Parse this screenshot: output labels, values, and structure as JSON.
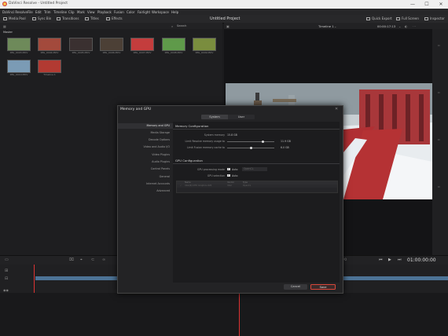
{
  "window": {
    "title": "DaVinci Resolve - Untitled Project",
    "minimize": "—",
    "maximize": "☐",
    "close": "✕"
  },
  "menu": [
    "DaVinci Resolve",
    "File",
    "Edit",
    "Trim",
    "Timeline",
    "Clip",
    "Mark",
    "View",
    "Playback",
    "Fusion",
    "Color",
    "Fairlight",
    "Workspace",
    "Help"
  ],
  "toolbar": {
    "media_pool": "Media Pool",
    "sync_bin": "Sync Bin",
    "transitions": "Transitions",
    "titles": "Titles",
    "effects": "Effects",
    "project_title": "Untitled Project",
    "quick_export": "Quick Export",
    "full_screen": "Full Screen",
    "inspector": "Inspector"
  },
  "pool": {
    "search": "Search",
    "bin_name": "Master",
    "clips": [
      {
        "label": "IMG_0403.MOV",
        "color": "#6e8a5a"
      },
      {
        "label": "IMG_0404.MOV",
        "color": "#a34a3c"
      },
      {
        "label": "IMG_0405.MOV",
        "color": "#3a3030"
      },
      {
        "label": "IMG_0406.MOV",
        "color": "#4c4036"
      },
      {
        "label": "IMG_0407.MOV",
        "color": "#c43d3d"
      },
      {
        "label": "IMG_0408.MOV",
        "color": "#5f9a4a"
      },
      {
        "label": "IMG_0409.MOV",
        "color": "#7a8d3e"
      },
      {
        "label": "IMG_0410.MOV",
        "color": "#7b9bb5"
      },
      {
        "label": "Timeline 1",
        "color": "#b23a32"
      }
    ]
  },
  "viewer": {
    "timeline_name": "Timeline 1",
    "source_timecode": "00:00:17:13",
    "timecode": "01:00:00:00"
  },
  "dialog": {
    "title": "Memory and GPU",
    "close": "✕",
    "tabs": [
      "System",
      "User"
    ],
    "active_tab": "System",
    "nav": [
      "Memory and GPU",
      "Media Storage",
      "Decode Options",
      "Video and Audio I/O",
      "Video Plugins",
      "Audio Plugins",
      "Control Panels",
      "General",
      "Internet Accounts",
      "Advanced"
    ],
    "memory": {
      "section": "Memory Configuration",
      "system_memory_label": "System memory",
      "system_memory_value": "15.8 GB",
      "resolve_label": "Limit Resolve memory usage to",
      "resolve_value": "11.9 GB",
      "resolve_fraction": 0.75,
      "fusion_label": "Limit Fusion memory cache to",
      "fusion_value": "6.0 GB",
      "fusion_fraction": 0.5
    },
    "gpu": {
      "section": "GPU Configuration",
      "processing_label": "GPU processing mode",
      "processing_auto": "Auto",
      "processing_mode": "OpenCL",
      "selection_label": "GPU selection",
      "selection_auto": "Auto",
      "table_headers": [
        "Name",
        "Vendor",
        "Type"
      ],
      "table_row": [
        "Intel(R) UHD Graphics 620",
        "Intel",
        "OpenCL"
      ]
    },
    "cancel": "Cancel",
    "save": "Save",
    "accent": "#d9473a"
  }
}
